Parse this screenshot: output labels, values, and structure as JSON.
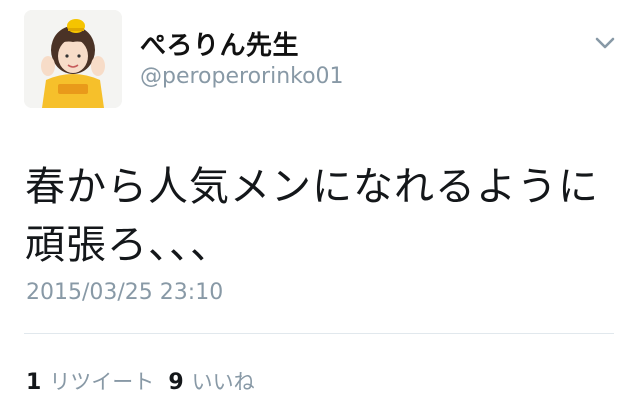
{
  "user": {
    "display_name": "ぺろりん先生",
    "screen_name": "@peroperorinko01",
    "avatar_icon": "profile-photo-icon"
  },
  "menu": {
    "icon": "chevron-down-icon"
  },
  "tweet": {
    "text": "春から人気メンになれるように\n頑張ろ、、、",
    "timestamp": "2015/03/25 23:10"
  },
  "stats": {
    "retweets": {
      "count": "1",
      "label": "リツイート"
    },
    "likes": {
      "count": "9",
      "label": "いいね"
    }
  },
  "colors": {
    "text": "#14171a",
    "secondary": "#8899a6",
    "divider": "#e1e8ed"
  }
}
